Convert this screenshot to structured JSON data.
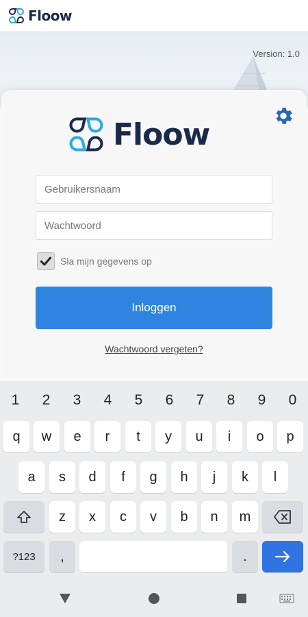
{
  "header": {
    "app_name": "Floow"
  },
  "banner": {
    "version": "Version: 1.0"
  },
  "card": {
    "logo_text": "Floow",
    "username_placeholder": "Gebruikersnaam",
    "password_placeholder": "Wachtwoord",
    "remember_label": "Sla mijn gegevens op",
    "remember_checked": true,
    "login_label": "Inloggen",
    "forgot_label": "Wachtwoord vergeten?"
  },
  "keyboard": {
    "numbers": [
      "1",
      "2",
      "3",
      "4",
      "5",
      "6",
      "7",
      "8",
      "9",
      "0"
    ],
    "row1": [
      "q",
      "w",
      "e",
      "r",
      "t",
      "y",
      "u",
      "i",
      "o",
      "p"
    ],
    "row2": [
      "a",
      "s",
      "d",
      "f",
      "g",
      "h",
      "j",
      "k",
      "l"
    ],
    "row3": [
      "z",
      "x",
      "c",
      "v",
      "b",
      "n",
      "m"
    ],
    "symbols_label": "?123",
    "comma_label": ",",
    "period_label": "."
  },
  "colors": {
    "brand_dark": "#1b2a4a",
    "brand_light": "#2fa7e6",
    "accent": "#2f84e0",
    "gear": "#2a66b3"
  },
  "icons": [
    "gear-icon",
    "shift-icon",
    "backspace-icon",
    "enter-arrow-icon",
    "back-triangle-icon",
    "home-circle-icon",
    "recents-square-icon",
    "keyboard-icon",
    "checkmark-icon"
  ]
}
